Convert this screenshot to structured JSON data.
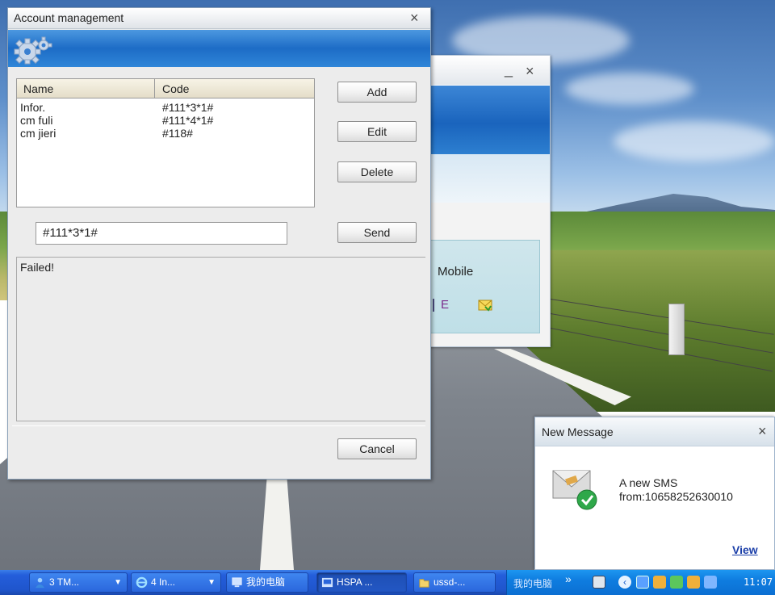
{
  "account_window": {
    "title": "Account management",
    "columns": [
      "Name",
      "Code"
    ],
    "rows": [
      {
        "name": "Infor.",
        "code": "#111*3*1#"
      },
      {
        "name": "cm fuli",
        "code": "#111*4*1#"
      },
      {
        "name": "cm jieri",
        "code": "#118#"
      }
    ],
    "buttons": {
      "add": "Add",
      "edit": "Edit",
      "delete": "Delete",
      "send": "Send",
      "cancel": "Cancel"
    },
    "code_input_value": "#111*3*1#",
    "result_text": "Failed!"
  },
  "background_window": {
    "minimize_glyph": "_",
    "close_glyph": "×",
    "label": "Mobile",
    "letter": "E"
  },
  "message_popup": {
    "title": "New Message",
    "line1": "A new SMS",
    "line2": "from:10658252630010",
    "view_link": "View"
  },
  "taskbar": {
    "tasks": [
      {
        "label": "3 TM...",
        "icon": "users-icon"
      },
      {
        "label": "4 In...",
        "icon": "ie-icon"
      },
      {
        "label": "我的电脑",
        "icon": "computer-icon"
      },
      {
        "label": "HSPA ...",
        "icon": "hspa-icon"
      },
      {
        "label": "ussd-...",
        "icon": "folder-icon"
      }
    ],
    "tray_label": "我的电脑",
    "tray_chevron": "»",
    "clock": "11:07"
  },
  "colors": {
    "taskbar_blue": "#245edb",
    "tray_blue": "#0f7de0",
    "banner_blue": "#1d6cc6",
    "link_blue": "#1a3ea8"
  }
}
